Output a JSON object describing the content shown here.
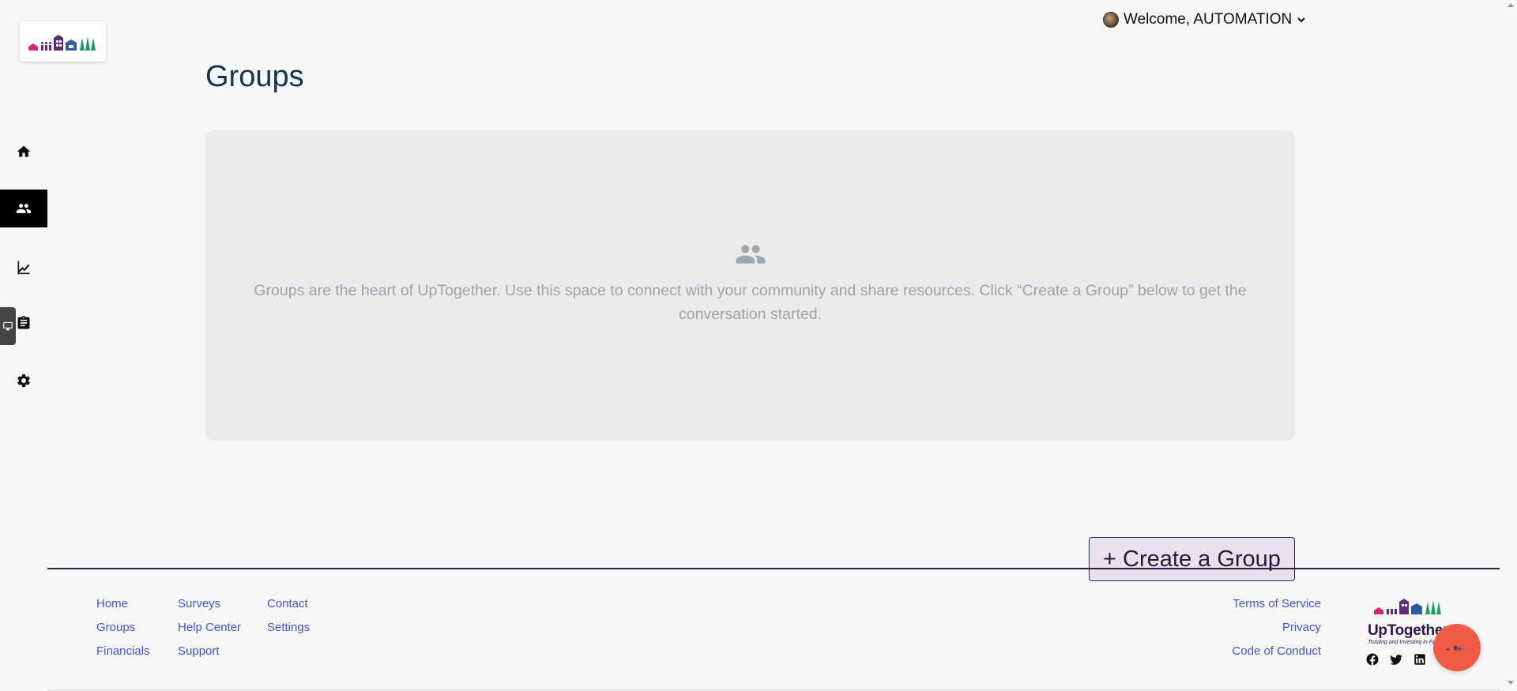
{
  "app": {
    "title": "Groups"
  },
  "header": {
    "welcome_text": "Welcome, AUTOMATION",
    "avatar_icon": "user-avatar",
    "dropdown_icon": "chevron-down-icon"
  },
  "sidebar": {
    "items": [
      {
        "name": "home",
        "icon": "home-icon",
        "active": false
      },
      {
        "name": "groups",
        "icon": "people-icon",
        "active": true
      },
      {
        "name": "financials",
        "icon": "chart-icon",
        "active": false
      },
      {
        "name": "surveys",
        "icon": "clipboard-icon",
        "active": false
      },
      {
        "name": "settings",
        "icon": "gear-icon",
        "active": false
      }
    ]
  },
  "main": {
    "title": "Groups",
    "empty_state": {
      "icon": "people-icon",
      "text": "Groups are the heart of UpTogether. Use this space to connect with your community and share resources. Click “Create a Group” below to get the conversation started."
    },
    "create_button": "+ Create a Group"
  },
  "footer": {
    "col1": [
      "Home",
      "Groups",
      "Financials"
    ],
    "col2": [
      "Surveys",
      "Help Center",
      "Support"
    ],
    "col3": [
      "Contact",
      "Settings"
    ],
    "legal": [
      "Terms of Service",
      "Privacy",
      "Code of Conduct"
    ],
    "brand": {
      "name": "UpTogether",
      "tagline": "Trusting and Investing in Fa"
    },
    "socials": [
      "facebook-icon",
      "twitter-icon",
      "linkedin-icon"
    ]
  },
  "colors": {
    "accent": "#13334e",
    "link": "#3f55c9",
    "chat": "#ef5b45",
    "brand": "#2b1946"
  }
}
